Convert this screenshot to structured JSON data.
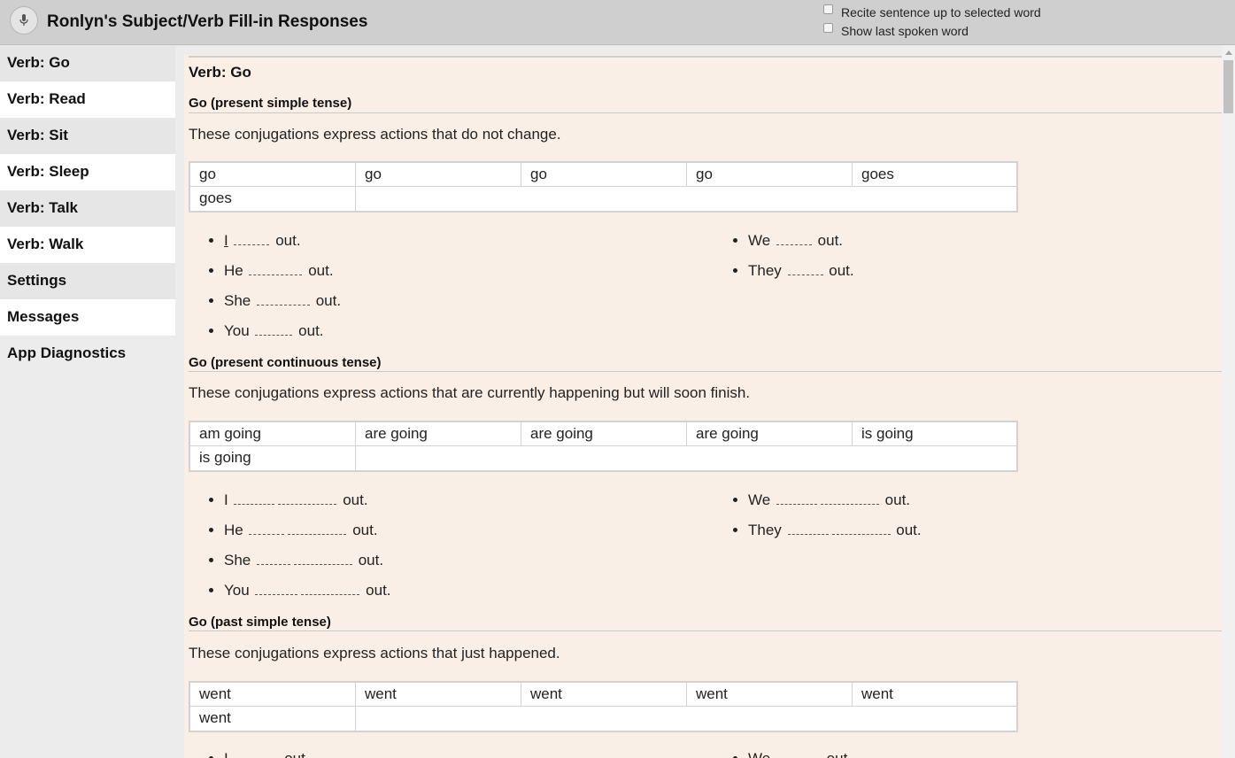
{
  "app": {
    "title": "Ronlyn's Subject/Verb Fill-in Responses",
    "options": [
      "Recite sentence up to selected word",
      "Show last spoken word"
    ]
  },
  "sidebar": {
    "items": [
      "Verb: Go",
      "Verb: Read",
      "Verb: Sit",
      "Verb: Sleep",
      "Verb: Talk",
      "Verb: Walk",
      "Settings",
      "Messages",
      "App Diagnostics"
    ]
  },
  "main": {
    "verb_title": "Verb: Go",
    "sections": [
      {
        "title": "Go (present simple tense)",
        "description": "These conjugations express actions that do not change.",
        "table": [
          "go",
          "go",
          "go",
          "go",
          "goes",
          "goes"
        ],
        "left": [
          {
            "subject": "I",
            "suffix": "out."
          },
          {
            "subject": "He",
            "suffix": "out."
          },
          {
            "subject": "She",
            "suffix": "out."
          },
          {
            "subject": "You",
            "suffix": "out."
          }
        ],
        "right": [
          {
            "subject": "We",
            "suffix": "out."
          },
          {
            "subject": "They",
            "suffix": "out."
          }
        ]
      },
      {
        "title": "Go (present continuous tense)",
        "description": "These conjugations express actions that are currently happening but will soon finish.",
        "table": [
          "am going",
          "are going",
          "are going",
          "are going",
          "is going",
          "is going"
        ],
        "left": [
          {
            "subject": "I",
            "suffix": "out."
          },
          {
            "subject": "He",
            "suffix": "out."
          },
          {
            "subject": "She",
            "suffix": "out."
          },
          {
            "subject": "You",
            "suffix": "out."
          }
        ],
        "right": [
          {
            "subject": "We",
            "suffix": "out."
          },
          {
            "subject": "They",
            "suffix": "out."
          }
        ]
      },
      {
        "title": "Go (past simple tense)",
        "description": "These conjugations express actions that just happened.",
        "table": [
          "went",
          "went",
          "went",
          "went",
          "went",
          "went"
        ],
        "left": [
          {
            "subject": "I",
            "suffix": "out."
          }
        ],
        "right": [
          {
            "subject": "We",
            "suffix": "out."
          }
        ]
      }
    ]
  }
}
